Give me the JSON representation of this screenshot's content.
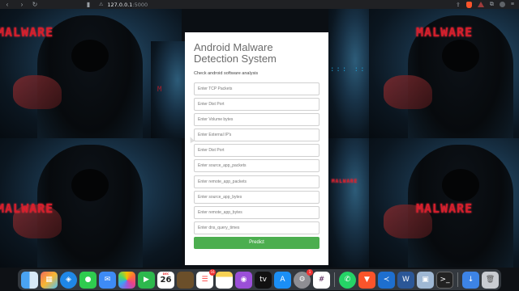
{
  "browser": {
    "address": {
      "host": "127.0.0.1",
      "port": ":5000"
    }
  },
  "background": {
    "words": [
      "MALWARE",
      "MALWARE",
      "MALWARE",
      "MALWARE",
      "MALWARE"
    ]
  },
  "form": {
    "title": "Android Malware Detection System",
    "subtitle": "Check android software analysis",
    "fields": [
      {
        "placeholder": "Enter TCP Packets",
        "value": ""
      },
      {
        "placeholder": "Enter Dist Port",
        "value": ""
      },
      {
        "placeholder": "Enter Volume bytes",
        "value": ""
      },
      {
        "placeholder": "Enter External IP's",
        "value": ""
      },
      {
        "placeholder": "Enter Dist Port",
        "value": ""
      },
      {
        "placeholder": "Enter source_app_packets",
        "value": ""
      },
      {
        "placeholder": "Enter remote_app_packets",
        "value": ""
      },
      {
        "placeholder": "Enter source_app_bytes",
        "value": ""
      },
      {
        "placeholder": "Enter remote_app_bytes",
        "value": ""
      },
      {
        "placeholder": "Enter dns_query_times",
        "value": ""
      }
    ],
    "submit_label": "Predict",
    "submit_color": "#4cae4f"
  },
  "dock": {
    "calendar": {
      "month": "DEC",
      "day": "26"
    },
    "badges": {
      "reminders": "16",
      "system_settings": "1"
    },
    "icons": [
      "finder-icon",
      "launchpad-icon",
      "safari-icon",
      "messages-icon",
      "mail-icon",
      "photos-icon",
      "facetime-icon",
      "calendar-icon",
      "notes-icon",
      "reminders-icon",
      "notes-yellow-icon",
      "podcasts-icon",
      "appletv-icon",
      "app-store-icon",
      "system-settings-icon",
      "slack-icon",
      "whatsapp-icon",
      "brave-icon",
      "vscode-icon",
      "word-icon",
      "preview-icon",
      "terminal-icon",
      "downloads-icon",
      "trash-icon"
    ]
  }
}
